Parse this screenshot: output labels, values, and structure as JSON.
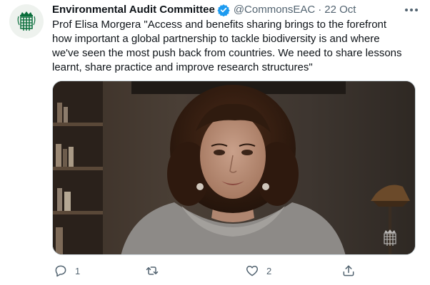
{
  "tweet": {
    "display_name": "Environmental Audit Committee",
    "handle": "@CommonsEAC",
    "separator": "·",
    "time": "22 Oct",
    "text": "Prof Elisa Morgera \"Access and benefits sharing brings to the forefront\nhow important a global partnership to tackle biodiversity is and where\nwe've seen the most push back from countries. We need to share lessons\nlearnt, share practice and improve research structures\""
  },
  "icons": {
    "avatar": "portcullis-logo",
    "verified": "verified-badge-icon",
    "more": "more-options-icon",
    "reply": "reply-icon",
    "retweet": "retweet-icon",
    "like": "heart-icon",
    "share": "share-icon",
    "watermark": "portcullis-watermark"
  },
  "actions": {
    "reply_count": "1",
    "retweet_count": "",
    "like_count": "2"
  },
  "colors": {
    "brand_green": "#0a6e3c",
    "verified_blue": "#1d9bf0",
    "secondary_text": "#536471"
  }
}
